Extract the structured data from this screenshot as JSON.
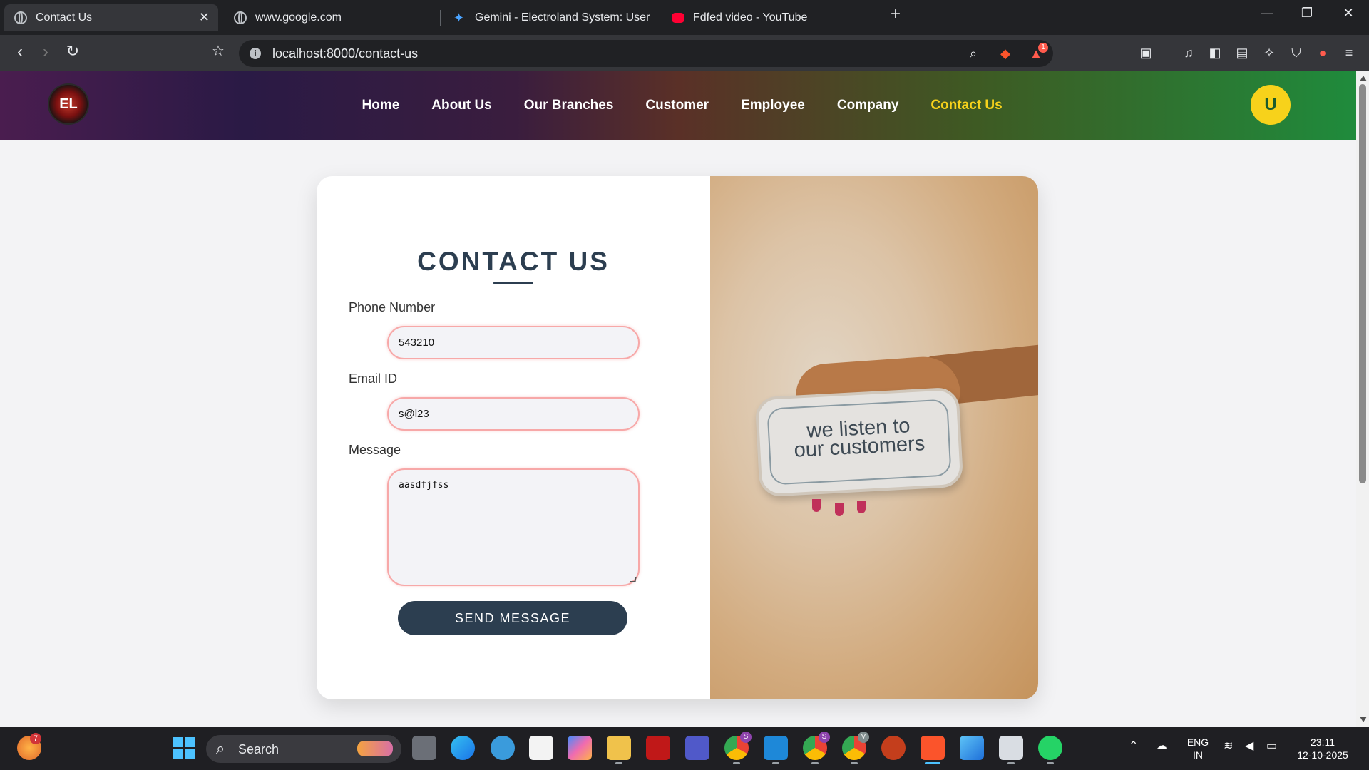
{
  "browser": {
    "tabs": [
      {
        "title": "Contact Us",
        "active": true
      },
      {
        "title": "www.google.com",
        "active": false
      },
      {
        "title": "Gemini - Electroland System: User Ro",
        "active": false
      },
      {
        "title": "Fdfed video - YouTube",
        "active": false
      }
    ],
    "url": "localhost:8000/contact-us",
    "new_tab": "+",
    "shields_badge": "1"
  },
  "site": {
    "logo_text": "EL",
    "nav": [
      "Home",
      "About Us",
      "Our Branches",
      "Customer",
      "Employee",
      "Company",
      "Contact Us"
    ],
    "active_nav": "Contact Us",
    "avatar_letter": "U",
    "colors": {
      "accent": "#f7d21b",
      "primary": "#2c3e50",
      "input_border": "#f7a8a8"
    }
  },
  "form": {
    "title": "CONTACT US",
    "phone_label": "Phone Number",
    "phone_value": "543210",
    "email_label": "Email ID",
    "email_value": "s@l23",
    "message_label": "Message",
    "message_value": "aasdfjfss",
    "submit_label": "SEND MESSAGE"
  },
  "image": {
    "sign_line1": "we listen to",
    "sign_line2": "our customers"
  },
  "taskbar": {
    "search_label": "Search",
    "weather_badge": "7",
    "lang_line1": "ENG",
    "lang_line2": "IN",
    "time": "23:11",
    "date": "12-10-2025",
    "badges": {
      "chrome_s1": "S",
      "chrome_s2": "S",
      "chrome_v": "V"
    }
  }
}
